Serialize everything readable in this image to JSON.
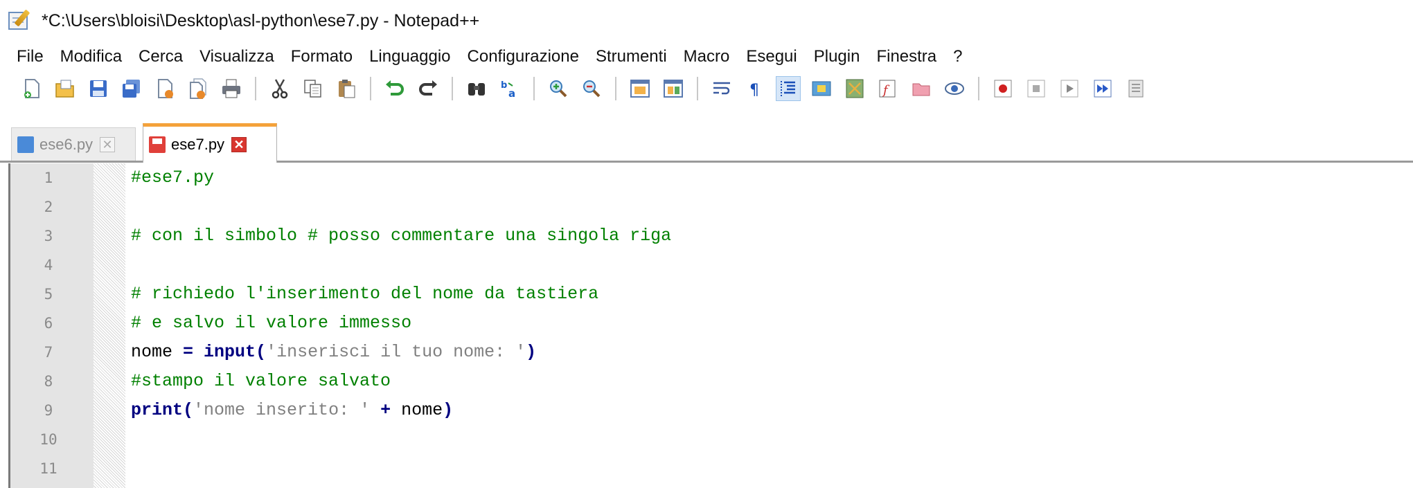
{
  "window": {
    "title": "*C:\\Users\\bloisi\\Desktop\\asl-python\\ese7.py - Notepad++"
  },
  "menu": {
    "items": [
      "File",
      "Modifica",
      "Cerca",
      "Visualizza",
      "Formato",
      "Linguaggio",
      "Configurazione",
      "Strumenti",
      "Macro",
      "Esegui",
      "Plugin",
      "Finestra",
      "?"
    ]
  },
  "toolbar": {
    "icons": [
      "new-file-icon",
      "open-file-icon",
      "save-icon",
      "save-all-icon",
      "close-icon",
      "close-all-icon",
      "print-icon",
      "cut-icon",
      "copy-icon",
      "paste-icon",
      "undo-icon",
      "redo-icon",
      "find-icon",
      "replace-icon",
      "zoom-in-icon",
      "zoom-out-icon",
      "sync-vertical-icon",
      "sync-horizontal-icon",
      "word-wrap-icon",
      "show-all-characters-icon",
      "indent-guide-icon",
      "user-language-icon",
      "document-map-icon",
      "function-list-icon",
      "folder-as-workspace-icon",
      "monitoring-icon",
      "record-macro-icon",
      "stop-recording-icon",
      "playback-icon",
      "run-multiple-icon",
      "save-macro-icon"
    ]
  },
  "tabs": [
    {
      "label": "ese6.py",
      "active": false
    },
    {
      "label": "ese7.py",
      "active": true
    }
  ],
  "editor": {
    "line_numbers": [
      "1",
      "2",
      "3",
      "4",
      "5",
      "6",
      "7",
      "8",
      "9",
      "10",
      "11"
    ],
    "lines": [
      {
        "type": "comment",
        "text": "#ese7.py"
      },
      {
        "type": "blank",
        "text": ""
      },
      {
        "type": "comment",
        "text": "# con il simbolo # posso commentare una singola riga"
      },
      {
        "type": "blank",
        "text": ""
      },
      {
        "type": "comment",
        "text": "# richiedo l'inserimento del nome da tastiera"
      },
      {
        "type": "comment",
        "text": "# e salvo il valore immesso"
      },
      {
        "type": "code",
        "parts": {
          "ident1": "nome",
          "op1": " = ",
          "func": "input",
          "open": "(",
          "string": "'inserisci il tuo nome: '",
          "close": ")"
        }
      },
      {
        "type": "comment",
        "text": "#stampo il valore salvato"
      },
      {
        "type": "code",
        "parts": {
          "func": "print",
          "open": "(",
          "string": "'nome inserito: '",
          "op": " + ",
          "ident": "nome",
          "close": ")"
        }
      },
      {
        "type": "blank",
        "text": ""
      },
      {
        "type": "blank",
        "text": ""
      }
    ]
  },
  "colors": {
    "comment": "#008000",
    "keyword": "#000080",
    "string": "#808080",
    "active_tab_accent": "#f4a23a",
    "gutter_bg": "#e4e4e4"
  }
}
